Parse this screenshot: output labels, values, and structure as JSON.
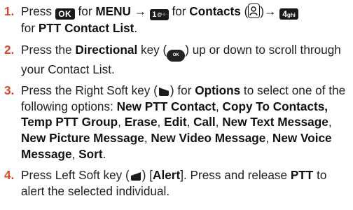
{
  "steps": [
    {
      "number": "1.",
      "t1": "Press ",
      "k_ok": "OK",
      "t2": " for ",
      "b_menu": "MENU",
      "arrow1": " → ",
      "k_one": "1",
      "k_one_sub": "@⁘",
      "t3": " for ",
      "b_contacts": "Contacts",
      "paren_open": " (",
      "contacts_icon": "contacts-icon",
      "paren_close": ")",
      "arrow2": "→ ",
      "k_four": "4",
      "k_four_sub": "ghi",
      "line2_pre": "for ",
      "b_list": "PTT Contact List",
      "line2_post": "."
    },
    {
      "number": "2.",
      "t1": "Press the ",
      "b_dir": "Directional",
      "t2": " key (",
      "dir_icon_text": "OK",
      "t3": ") up or down to scroll through your Contact List."
    },
    {
      "number": "3.",
      "t1": "Press the Right Soft key (",
      "t2": ") for ",
      "b_options": "Options",
      "t3": " to select one of the following options: ",
      "options": [
        {
          "label": "New PTT Contact",
          "sep": ", "
        },
        {
          "label": "Copy To Contacts, Temp PTT Group",
          "sep": ", "
        },
        {
          "label": "Erase",
          "sep": ", "
        },
        {
          "label": "Edit",
          "sep": ", "
        },
        {
          "label": "Call",
          "sep": ", "
        },
        {
          "label": "New Text Message",
          "sep": ", "
        },
        {
          "label": "New Picture Message",
          "sep": ", "
        },
        {
          "label": "New Video Message",
          "sep": ", "
        },
        {
          "label": "New Voice Message",
          "sep": ", "
        },
        {
          "label": "Sort",
          "sep": "."
        }
      ]
    },
    {
      "number": "4.",
      "t1": "Press Left Soft key (",
      "t2": ") [",
      "b_alert": "Alert",
      "t3": "]. Press and release ",
      "b_ptt": "PTT",
      "t4": " to alert the selected individual."
    }
  ],
  "colors": {
    "step_number": "#d8452a",
    "key_background": "#1a1a1a"
  }
}
